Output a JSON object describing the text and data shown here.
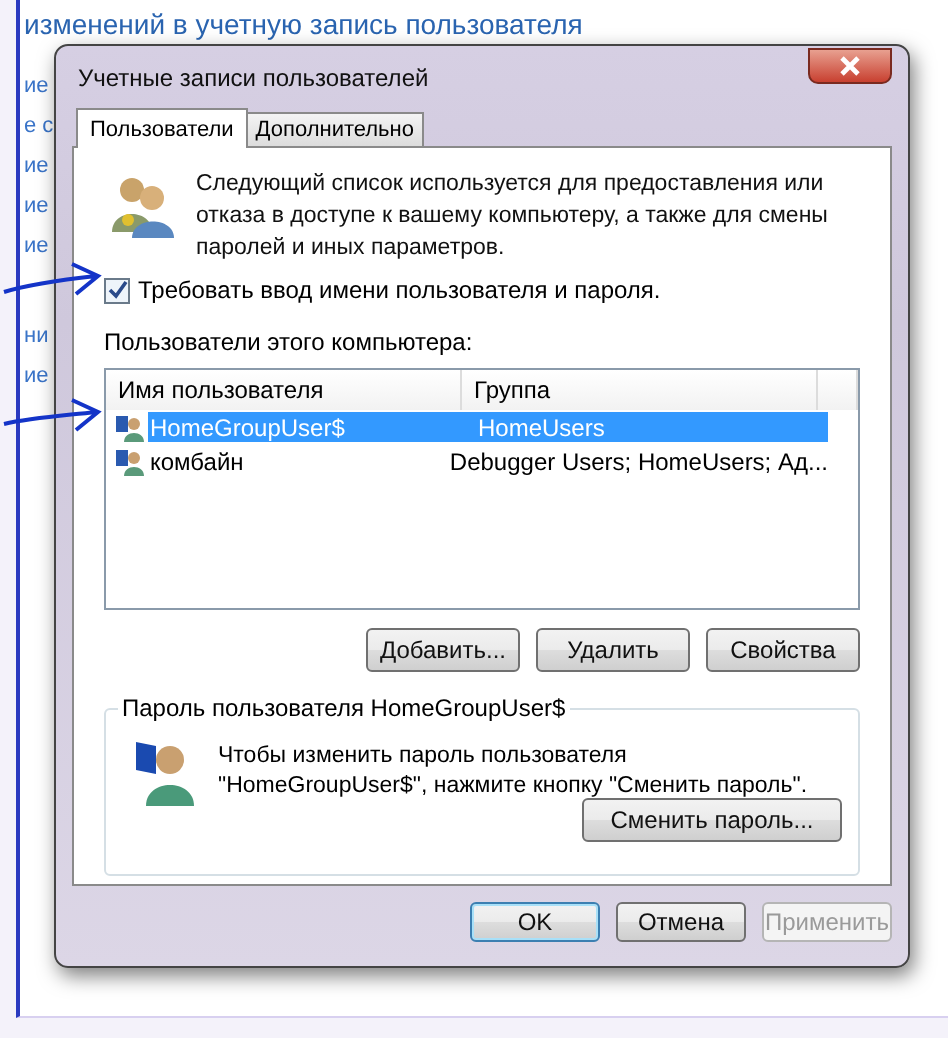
{
  "background_window": {
    "heading": "изменений в учетную запись пользователя",
    "side_links_top": [
      "ие",
      "е с",
      "ие",
      "ие",
      "ие"
    ],
    "side_links_bottom": [
      "ни",
      "ие"
    ]
  },
  "dialog": {
    "title": "Учетные записи пользователей"
  },
  "tabs": [
    {
      "label": "Пользователи",
      "selected": true
    },
    {
      "label": "Дополнительно",
      "selected": false
    }
  ],
  "intro": "Следующий список используется для предоставления или отказа в доступе к вашему компьютеру, а также для смены паролей и иных параметров.",
  "require_login": {
    "label": "Требовать ввод имени пользователя и пароля.",
    "checked": true
  },
  "users_label": "Пользователи этого компьютера:",
  "table": {
    "columns": [
      "Имя пользователя",
      "Группа"
    ],
    "rows": [
      {
        "name": "HomeGroupUser$",
        "group": "HomeUsers",
        "selected": true
      },
      {
        "name": "комбайн",
        "group": "Debugger Users; HomeUsers; Ад...",
        "selected": false
      }
    ]
  },
  "user_buttons": [
    "Добавить...",
    "Удалить",
    "Свойства"
  ],
  "password_group": {
    "title": "Пароль пользователя HomeGroupUser$",
    "text": "Чтобы изменить пароль пользователя \"HomeGroupUser$\", нажмите кнопку \"Сменить пароль\".",
    "button": "Сменить пароль..."
  },
  "footer_buttons": [
    {
      "label": "OK",
      "disabled": false,
      "default": true
    },
    {
      "label": "Отмена",
      "disabled": false,
      "default": false
    },
    {
      "label": "Применить",
      "disabled": true,
      "default": false
    }
  ]
}
